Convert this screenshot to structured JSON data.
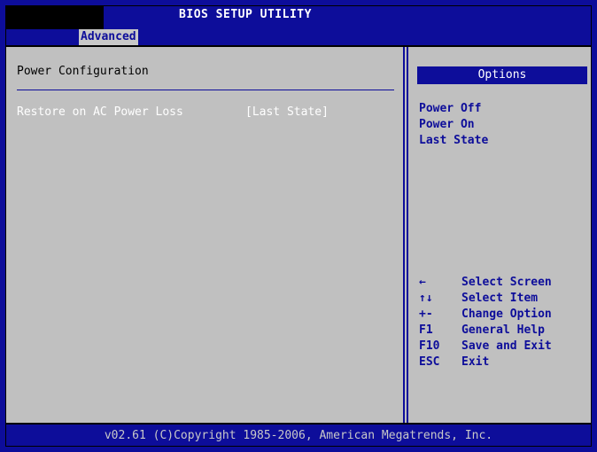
{
  "title": "BIOS SETUP UTILITY",
  "active_tab": "Advanced",
  "section": {
    "title": "Power Configuration",
    "settings": [
      {
        "label": "Restore on AC Power Loss",
        "value": "[Last State]"
      }
    ]
  },
  "options_panel": {
    "header": "Options",
    "items": [
      "Power Off",
      "Power On",
      "Last State"
    ]
  },
  "help": [
    {
      "key": "←",
      "desc": "Select Screen"
    },
    {
      "key": "↑↓",
      "desc": "Select Item"
    },
    {
      "key": "+-",
      "desc": "Change Option"
    },
    {
      "key": "F1",
      "desc": "General Help"
    },
    {
      "key": "F10",
      "desc": "Save and Exit"
    },
    {
      "key": "ESC",
      "desc": "Exit"
    }
  ],
  "footer": "v02.61 (C)Copyright 1985-2006, American Megatrends, Inc.",
  "colors": {
    "bios_blue": "#0d0d9a",
    "panel_gray": "#c0c0c0",
    "highlight_white": "#ffffff"
  }
}
